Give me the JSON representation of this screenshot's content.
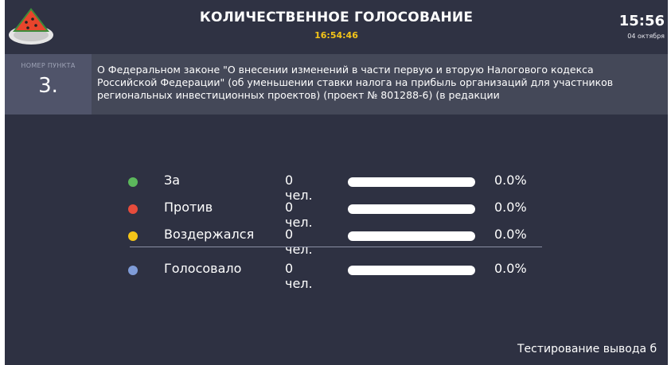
{
  "header": {
    "title": "КОЛИЧЕСТВЕННОЕ ГОЛОСОВАНИЕ",
    "timer": "16:54:46",
    "clock": "15:56",
    "date": "04 октября",
    "logo_icon": "watermelon-icon"
  },
  "item": {
    "number_label": "НОМЕР ПУНКТА",
    "number": "3.",
    "text": "О Федеральном законе \"О внесении изменений в части первую и вторую Налогового кодекса Российской Федерации\" (об уменьшении ставки налога на прибыль организаций для участников региональных инвестиционных проектов) (проект № 801288-6) (в редакции"
  },
  "results": [
    {
      "label": "За",
      "count": "0 чел.",
      "percent": "0.0%",
      "fraction": 0,
      "color": "#5cb85c"
    },
    {
      "label": "Против",
      "count": "0 чел.",
      "percent": "0.0%",
      "fraction": 0,
      "color": "#e74c3c"
    },
    {
      "label": "Воздержался",
      "count": "0 чел.",
      "percent": "0.0%",
      "fraction": 0,
      "color": "#f5c518"
    }
  ],
  "total": {
    "label": "Голосовало",
    "count": "0 чел.",
    "percent": "0.0%",
    "fraction": 0,
    "color": "#7f9cd8"
  },
  "ticker": "Тестирование вывода б",
  "colors": {
    "background": "#2e3142",
    "item_bar": "#444858",
    "timer": "#f5c518"
  }
}
